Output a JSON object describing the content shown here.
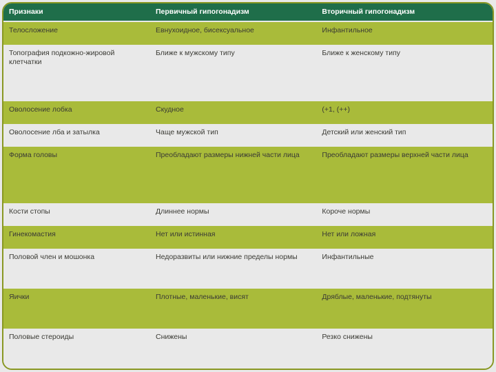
{
  "headers": {
    "c1": "Признаки",
    "c2": "Первичный гипогонадизм",
    "c3": "Вторичный гипогонадизм"
  },
  "rows": [
    {
      "c1": "Телосложение",
      "c2": "Евнухоидное, бисексуальное",
      "c3": "Инфантильное"
    },
    {
      "c1": "Топография подкожно-жировой клетчатки",
      "c2": "Ближе к мужскому типу",
      "c3": "Ближе к женскому типу"
    },
    {
      "c1": "Оволосение лобка",
      "c2": "Скудное",
      "c3": "(+1, (++)"
    },
    {
      "c1": "Оволосение лба и затылка",
      "c2": "Чаще мужской тип",
      "c3": "Детский или женский тип"
    },
    {
      "c1": "Форма головы",
      "c2": "Преобладают размеры нижней части лица",
      "c3": "Преобладают размеры верхней части лица"
    },
    {
      "c1": "Кости стопы",
      "c2": "Длиннее нормы",
      "c3": "Короче нормы"
    },
    {
      "c1": "Гинекомастия",
      "c2": "Нет или истинная",
      "c3": "Нет или ложная"
    },
    {
      "c1": "Половой член и мошонка",
      "c2": "Недоразвиты или нижние пределы нормы",
      "c3": "Инфантильные"
    },
    {
      "c1": "Яички",
      "c2": "Плотные, маленькие, висят",
      "c3": "Дряблые, маленькие, подтянуты"
    },
    {
      "c1": "Половые стероиды",
      "c2": "Снижены",
      "c3": "Резко снижены"
    }
  ]
}
